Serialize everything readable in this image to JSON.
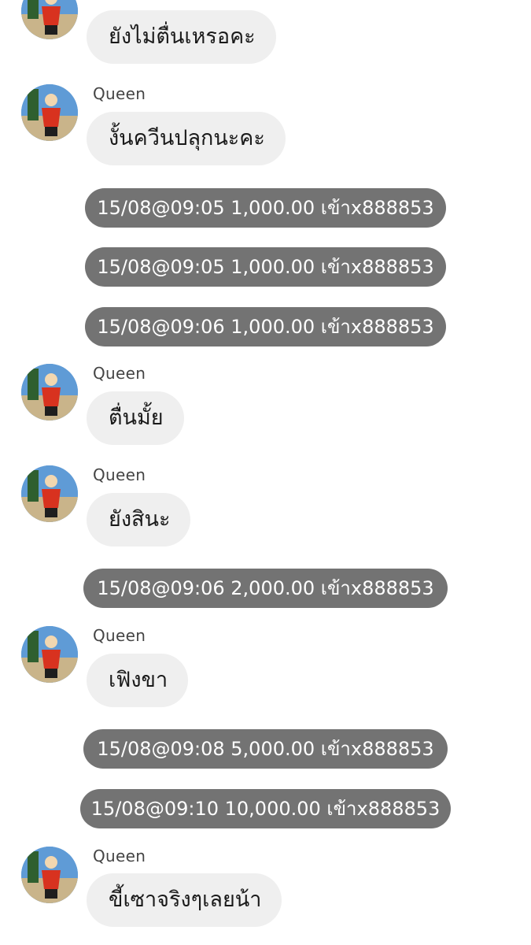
{
  "chat": {
    "messages": [
      {
        "kind": "incoming",
        "sender": "",
        "text": "ยังไม่ตื่นเหรอคะ"
      },
      {
        "kind": "incoming",
        "sender": "Queen",
        "text": "งั้นควีนปลุกนะคะ"
      },
      {
        "kind": "notification",
        "text": "15/08@09:05 1,000.00 เข้าx888853"
      },
      {
        "kind": "notification",
        "text": "15/08@09:05 1,000.00 เข้าx888853"
      },
      {
        "kind": "notification",
        "text": "15/08@09:06 1,000.00 เข้าx888853"
      },
      {
        "kind": "incoming",
        "sender": "Queen",
        "text": "ตื่นมั้ย"
      },
      {
        "kind": "incoming",
        "sender": "Queen",
        "text": "ยังสินะ"
      },
      {
        "kind": "notification",
        "text": "15/08@09:06 2,000.00 เข้าx888853"
      },
      {
        "kind": "incoming",
        "sender": "Queen",
        "text": "เฟิงขา"
      },
      {
        "kind": "notification",
        "text": "15/08@09:08 5,000.00 เข้าx888853"
      },
      {
        "kind": "notification",
        "text": "15/08@09:10 10,000.00 เข้าx888853"
      },
      {
        "kind": "incoming",
        "sender": "Queen",
        "text": "ขี้เซาจริงๆเลยน้า"
      }
    ]
  },
  "colors": {
    "incoming_bubble": "#efefef",
    "notification_bubble": "#737373",
    "sender_name": "#444444"
  },
  "icons": {
    "avatar": "profile-photo-icon"
  }
}
